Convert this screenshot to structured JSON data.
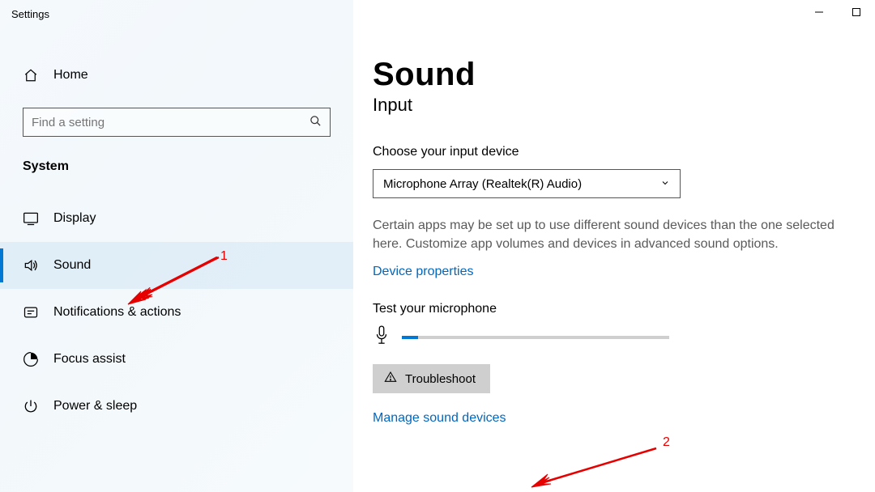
{
  "app_title": "Settings",
  "home_label": "Home",
  "search": {
    "placeholder": "Find a setting"
  },
  "section_header": "System",
  "nav": [
    {
      "key": "display",
      "label": "Display"
    },
    {
      "key": "sound",
      "label": "Sound"
    },
    {
      "key": "notifications",
      "label": "Notifications & actions"
    },
    {
      "key": "focus",
      "label": "Focus assist"
    },
    {
      "key": "power",
      "label": "Power & sleep"
    }
  ],
  "page": {
    "title": "Sound",
    "subtitle": "Input",
    "choose_label": "Choose your input device",
    "input_device_selected": "Microphone Array (Realtek(R) Audio)",
    "description": "Certain apps may be set up to use different sound devices than the one selected here. Customize app volumes and devices in advanced sound options.",
    "device_properties_link": "Device properties",
    "test_label": "Test your microphone",
    "mic_level_percent": 6,
    "troubleshoot_label": "Troubleshoot",
    "manage_devices_link": "Manage sound devices"
  },
  "annotations": {
    "one": "1",
    "two": "2"
  }
}
